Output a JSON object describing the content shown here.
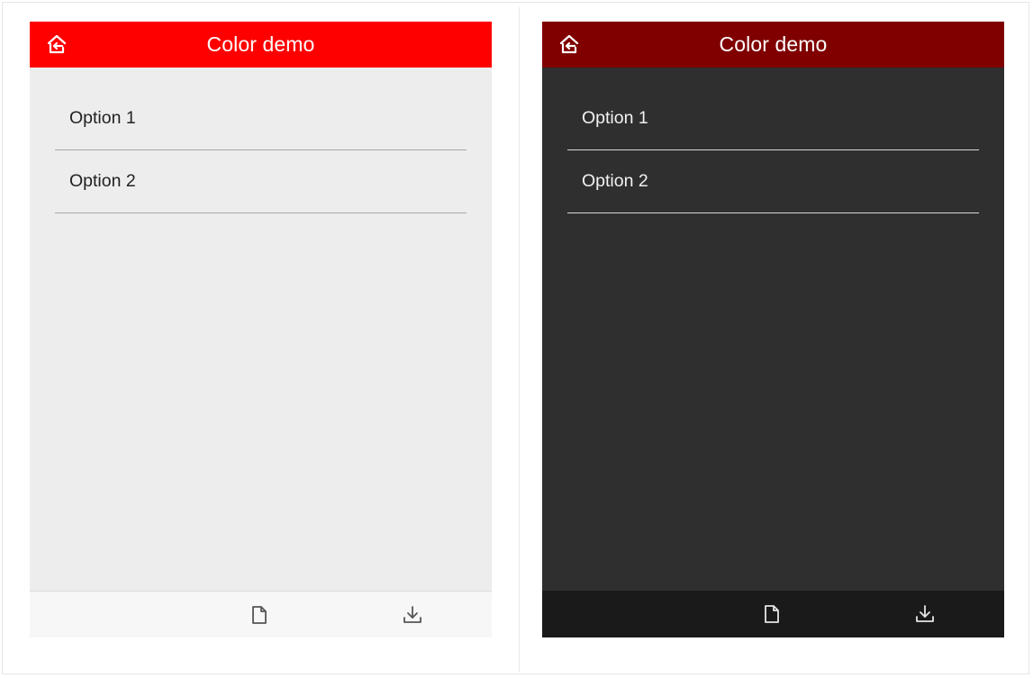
{
  "colors": {
    "light_header": "#ff0000",
    "dark_header": "#800000",
    "light_icon": "#555555",
    "dark_icon": "#e6e6e6"
  },
  "panels": [
    {
      "theme": "light",
      "header": {
        "title": "Color demo",
        "home_icon": "home-back-icon"
      },
      "list": [
        {
          "label": "Option 1"
        },
        {
          "label": "Option 2"
        }
      ],
      "bottom_bar": {
        "icons": [
          "file-icon",
          "download-icon"
        ]
      }
    },
    {
      "theme": "dark",
      "header": {
        "title": "Color demo",
        "home_icon": "home-back-icon"
      },
      "list": [
        {
          "label": "Option 1"
        },
        {
          "label": "Option 2"
        }
      ],
      "bottom_bar": {
        "icons": [
          "file-icon",
          "download-icon"
        ]
      }
    }
  ]
}
